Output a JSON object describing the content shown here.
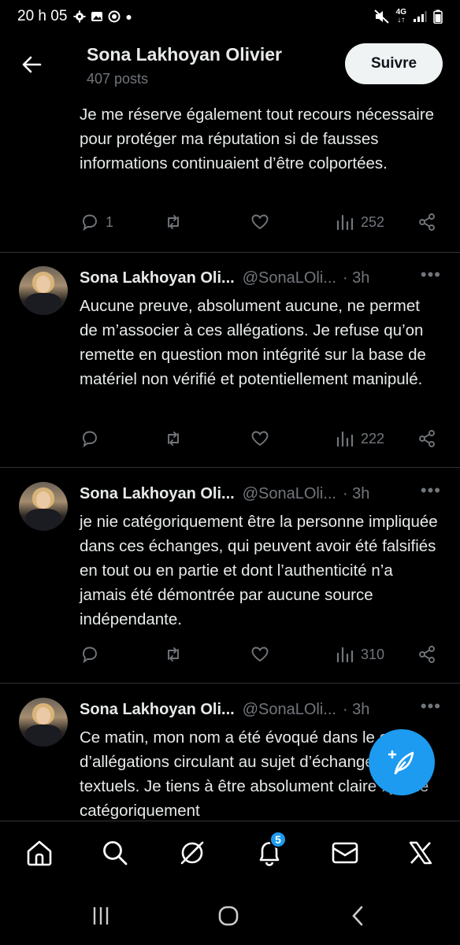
{
  "status_bar": {
    "time": "20 h 05",
    "network": "4G"
  },
  "header": {
    "title": "Sona Lakhoyan Olivier",
    "subtitle": "407 posts",
    "follow_label": "Suivre"
  },
  "partial_tweet": {
    "text": "Je me réserve également tout recours nécessaire pour protéger ma réputation si de fausses informations continuaient d’être colportées.",
    "replies": "1",
    "views": "252"
  },
  "tweets": [
    {
      "name": "Sona Lakhoyan Oli...",
      "handle": "@SonaLOli...",
      "time": "· 3h",
      "text": "Aucune preuve, absolument aucune, ne permet de m’associer à ces allégations. Je refuse qu’on remette en question mon intégrité sur la base de matériel non vérifié et potentiellement manipulé.",
      "views": "222"
    },
    {
      "name": "Sona Lakhoyan Oli...",
      "handle": "@SonaLOli...",
      "time": "· 3h",
      "text": "je nie catégoriquement être la personne impliquée dans ces échanges, qui peuvent avoir été falsifiés en tout ou en partie et dont l’authenticité n’a jamais été démontrée par aucune source indépendante.",
      "views": "310"
    },
    {
      "name": "Sona Lakhoyan Oli...",
      "handle": "@SonaLOli...",
      "time": "· 3h",
      "text": "Ce matin, mon nom a été évoqué dans le cadre d’allégations circulant au sujet d’échanges textuels. Je tiens à être absolument claire : je nie catégoriquement"
    }
  ],
  "bottom_nav": {
    "notifications_badge": "5"
  },
  "colors": {
    "accent": "#1d9bf0",
    "muted": "#71767b",
    "text": "#e7e9ea",
    "background": "#000000"
  }
}
